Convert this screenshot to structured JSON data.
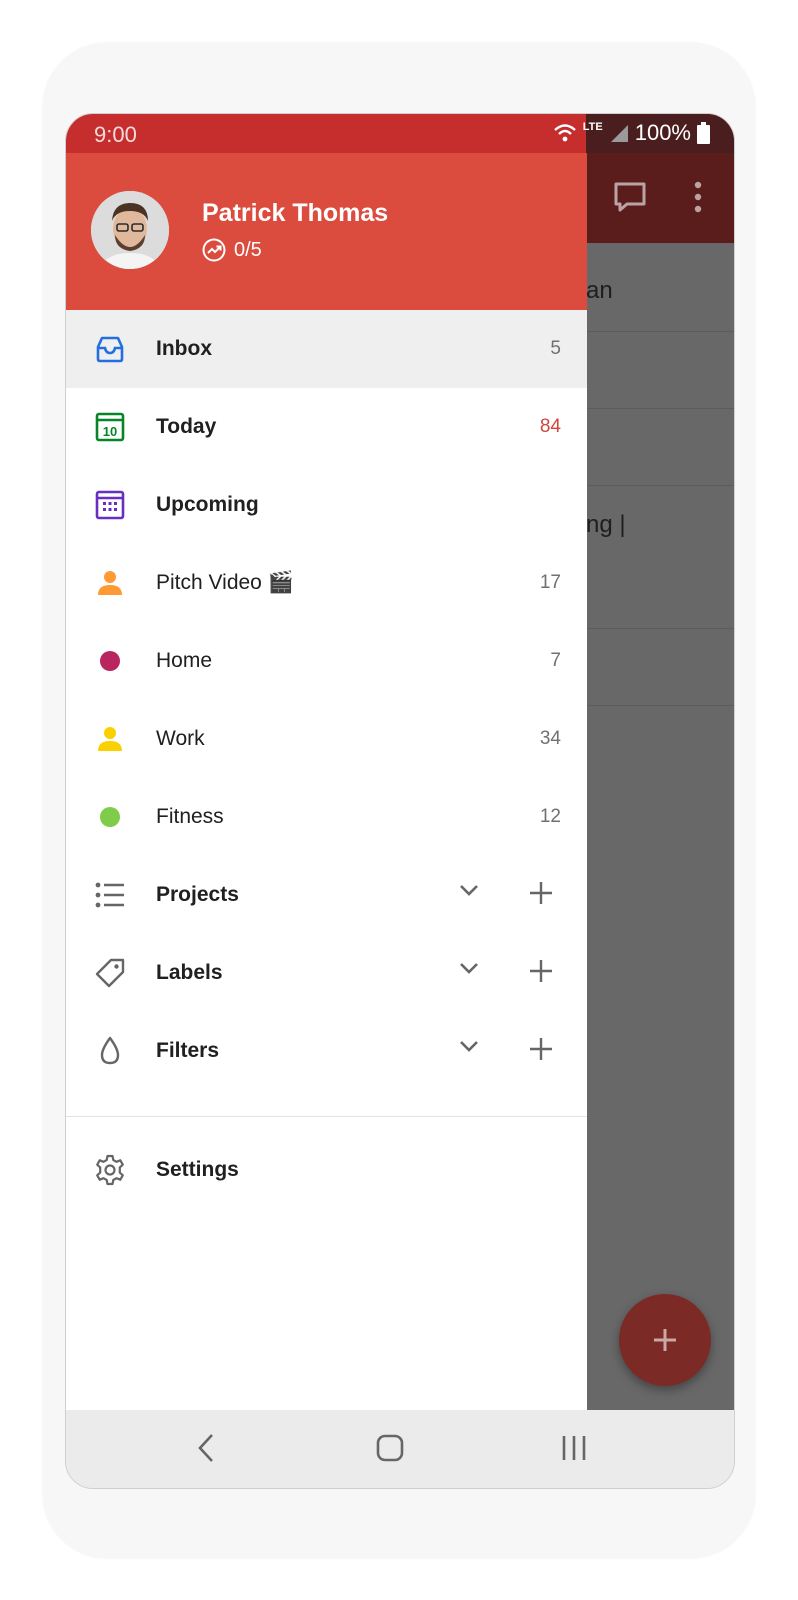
{
  "status": {
    "time": "9:00",
    "network": "LTE",
    "battery": "100%"
  },
  "user": {
    "name": "Patrick Thomas",
    "karma": "0/5"
  },
  "background_rows": [
    "an",
    "ng |"
  ],
  "nav": [
    {
      "label": "Inbox",
      "count": "5",
      "icon": "inbox-icon",
      "color": "#246fe0",
      "bold": true,
      "active": true
    },
    {
      "label": "Today",
      "count": "84",
      "icon": "calendar-today-icon",
      "color": "#058527",
      "bold": true,
      "count_color": "#d1453b"
    },
    {
      "label": "Upcoming",
      "count": "",
      "icon": "calendar-grid-icon",
      "color": "#692fc2",
      "bold": true
    },
    {
      "label": "Pitch Video 🎬",
      "count": "17",
      "icon": "person-icon",
      "color": "#ff9933"
    },
    {
      "label": "Home",
      "count": "7",
      "icon": "dot-icon",
      "color": "#b8255f"
    },
    {
      "label": "Work",
      "count": "34",
      "icon": "person-icon",
      "color": "#fad000"
    },
    {
      "label": "Fitness",
      "count": "12",
      "icon": "dot-icon",
      "color": "#7ecc49"
    }
  ],
  "sections": [
    {
      "label": "Projects",
      "icon": "list-icon"
    },
    {
      "label": "Labels",
      "icon": "tag-icon"
    },
    {
      "label": "Filters",
      "icon": "drop-icon"
    }
  ],
  "settings": {
    "label": "Settings",
    "icon": "gear-icon"
  }
}
